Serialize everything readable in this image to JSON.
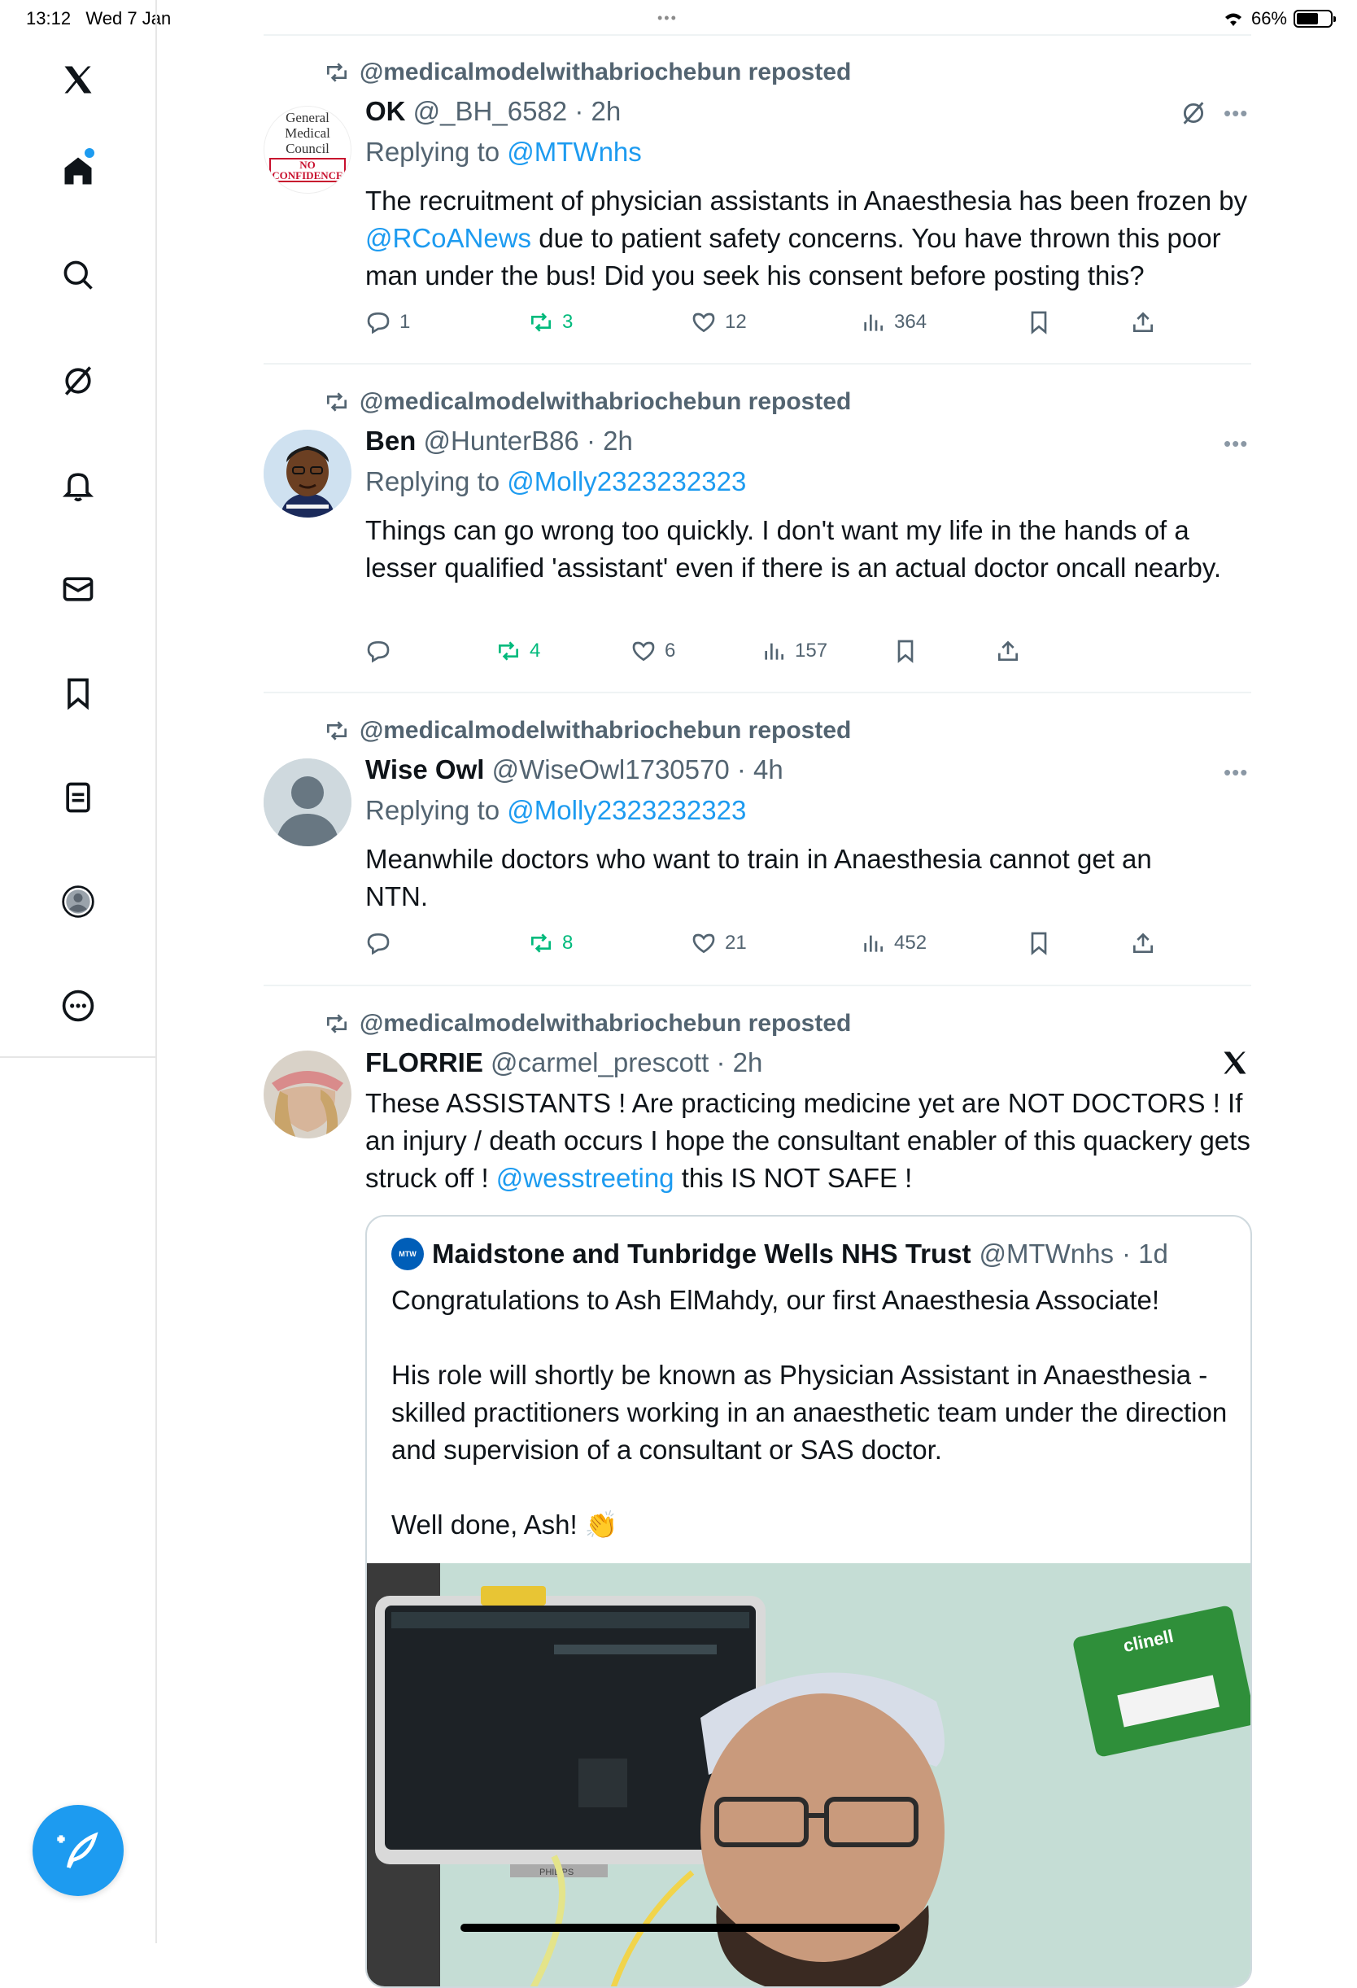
{
  "status": {
    "time": "13:12",
    "date": "Wed 7 Jan",
    "battery_pct": "66%",
    "battery_level": 0.66
  },
  "sidebar": {
    "items": [
      {
        "name": "x-logo-icon"
      },
      {
        "name": "home-icon"
      },
      {
        "name": "search-icon"
      },
      {
        "name": "grok-icon"
      },
      {
        "name": "notifications-icon"
      },
      {
        "name": "messages-icon"
      },
      {
        "name": "bookmarks-icon"
      },
      {
        "name": "lists-icon"
      },
      {
        "name": "profile-icon"
      },
      {
        "name": "more-icon"
      }
    ],
    "compose": "compose-icon"
  },
  "posts": [
    {
      "reposted_by": "@medicalmodelwithabriochebun reposted",
      "name": "OK",
      "handle": "@_BH_6582",
      "time": "· 2h",
      "replying_prefix": "Replying to",
      "replying_to": "@MTWnhs",
      "text_parts": [
        "The recruitment of physician assistants in Anaesthesia has been frozen by ",
        "@RCoANews",
        " due to patient safety concerns. You have thrown this poor man under the bus! Did you seek his consent before posting this?"
      ],
      "replies": "1",
      "reposts": "3",
      "likes": "12",
      "views": "364",
      "avatar_text": [
        "General",
        "Medical",
        "Council",
        "NO",
        "CONFIDENCE"
      ]
    },
    {
      "reposted_by": "@medicalmodelwithabriochebun reposted",
      "name": "Ben",
      "handle": "@HunterB86",
      "time": "· 2h",
      "replying_prefix": "Replying to",
      "replying_to": "@Molly2323232323",
      "text": "Things can go wrong too quickly. I don't want my life in the hands of a lesser qualified 'assistant' even if there is an actual doctor oncall nearby.",
      "replies": "",
      "reposts": "4",
      "likes": "6",
      "views": "157"
    },
    {
      "reposted_by": "@medicalmodelwithabriochebun reposted",
      "name": "Wise Owl",
      "handle": "@WiseOwl1730570",
      "time": "· 4h",
      "replying_prefix": "Replying to",
      "replying_to": "@Molly2323232323",
      "text": "Meanwhile doctors who want to train in Anaesthesia cannot get an NTN.",
      "replies": "",
      "reposts": "8",
      "likes": "21",
      "views": "452"
    },
    {
      "reposted_by": "@medicalmodelwithabriochebun reposted",
      "name": "FLORRIE",
      "handle": "@carmel_prescott",
      "time": "· 2h",
      "text_parts": [
        "These ASSISTANTS ! Are practicing medicine yet are NOT DOCTORS ! If an injury / death occurs I hope the consultant enabler of this quackery gets struck off ! ",
        "@wesstreeting",
        " this IS NOT SAFE !"
      ],
      "quote": {
        "logo_text": "MTW",
        "name": "Maidstone and Tunbridge Wells NHS Trust",
        "handle": "@MTWnhs",
        "time": "· 1d",
        "paragraphs": [
          "Congratulations to Ash ElMahdy, our first Anaesthesia Associate!",
          "His role will shortly be known as Physician Assistant in Anaesthesia - skilled practitioners working in an anaesthetic team under the direction and supervision of a consultant or SAS doctor.",
          "Well done, Ash! 👏"
        ],
        "photo_text": [
          "clinell",
          "PHILIPS"
        ]
      }
    }
  ],
  "colors": {
    "accent": "#1d9bf0",
    "repost_green": "#00ba7c",
    "secondary_text": "#536471"
  }
}
